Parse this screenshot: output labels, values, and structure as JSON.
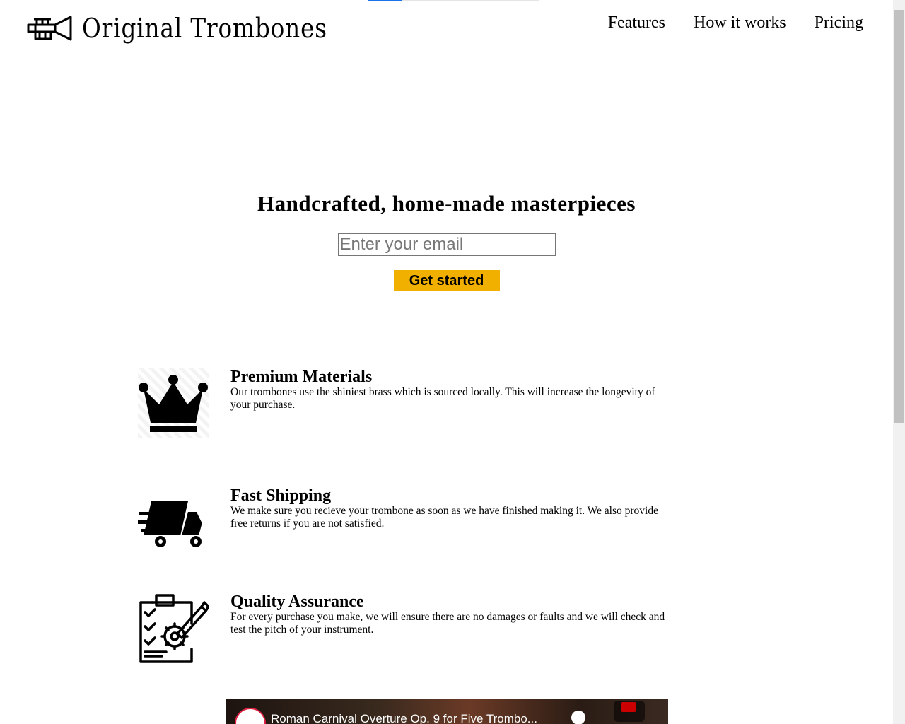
{
  "header": {
    "brand": "Original Trombones",
    "nav": [
      {
        "label": "Features"
      },
      {
        "label": "How it works"
      },
      {
        "label": "Pricing"
      }
    ]
  },
  "hero": {
    "title": "Handcrafted, home-made masterpieces",
    "email_placeholder": "Enter your email",
    "cta_label": "Get started"
  },
  "features": [
    {
      "title": "Premium Materials",
      "description": "Our trombones use the shiniest brass which is sourced locally. This will increase the longevity of your purchase.",
      "icon": "crown-icon"
    },
    {
      "title": "Fast Shipping",
      "description": "We make sure you recieve your trombone as soon as we have finished making it. We also provide free returns if you are not satisfied.",
      "icon": "truck-icon"
    },
    {
      "title": "Quality Assurance",
      "description": "For every purchase you make, we will ensure there are no damages or faults and we will check and test the pitch of your instrument.",
      "icon": "clipboard-gear-icon"
    }
  ],
  "video": {
    "title": "Roman Carnival Overture Op. 9 for Five Trombo..."
  },
  "colors": {
    "cta_background": "#f1b000",
    "text": "#000000"
  }
}
